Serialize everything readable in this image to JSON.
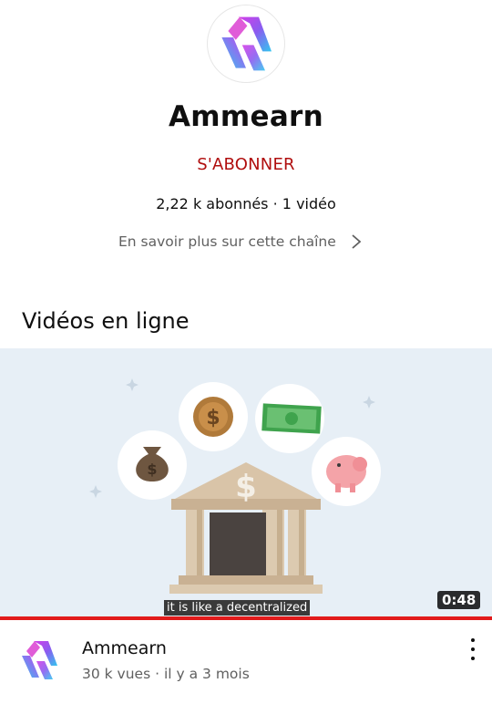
{
  "channel": {
    "name": "Ammearn",
    "subscribe_label": "S'ABONNER",
    "subscribers": "2,22 k abonnés",
    "separator": "·",
    "video_count": "1 vidéo",
    "about_label": "En savoir plus sur cette chaîne"
  },
  "section": {
    "title": "Vidéos en ligne"
  },
  "video": {
    "subtitle_text": "it is like a decentralized",
    "duration": "0:48",
    "watched_fraction": 1.0,
    "title": "Ammearn",
    "views": "30 k vues",
    "meta_separator": "·",
    "age": "il y a 3 mois"
  },
  "colors": {
    "subscribe": "#b00e0e",
    "progress": "#e21b1b",
    "logo_gradient_start": "#c43ef0",
    "logo_gradient_end": "#33c6ef"
  }
}
